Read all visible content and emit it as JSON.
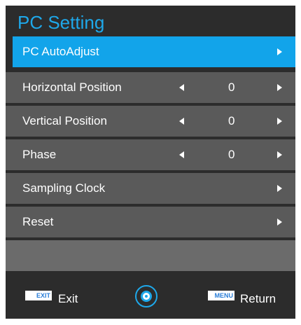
{
  "menu": {
    "title": "PC Setting",
    "items": [
      {
        "label": "PC AutoAdjust",
        "selected": true
      },
      {
        "label": "Horizontal Position",
        "value": "0"
      },
      {
        "label": "Vertical Position",
        "value": "0"
      },
      {
        "label": "Phase",
        "value": "0"
      },
      {
        "label": "Sampling Clock"
      },
      {
        "label": "Reset"
      }
    ]
  },
  "footer": {
    "exit_icon_text": "EXIT",
    "exit_label": "Exit",
    "menu_icon_text": "MENU",
    "return_label": "Return"
  },
  "colors": {
    "accent": "#1ea8ea",
    "selected_row": "#12a4ea",
    "row_bg": "#5a5a5a",
    "panel_bg": "#2c2c2c"
  },
  "icons": [
    "arrow-right-icon",
    "arrow-left-icon",
    "joystick-icon",
    "exit-key-icon",
    "menu-key-icon"
  ]
}
